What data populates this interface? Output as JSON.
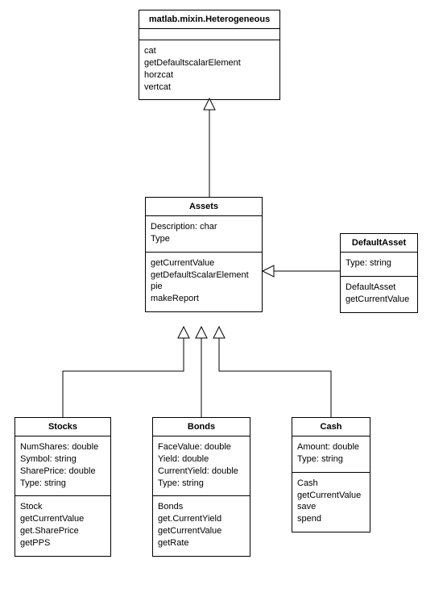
{
  "classes": {
    "heterogeneous": {
      "name": "matlab.mixin.Heterogeneous",
      "attributes": [],
      "methods": [
        "cat",
        "getDefaultscalarElement",
        "horzcat",
        "vertcat"
      ]
    },
    "assets": {
      "name": "Assets",
      "attributes": [
        "Description: char",
        "Type"
      ],
      "methods": [
        "getCurrentValue",
        "getDefaultScalarElement",
        "pie",
        "makeReport"
      ]
    },
    "defaultAsset": {
      "name": "DefaultAsset",
      "attributes": [
        "Type: string"
      ],
      "methods": [
        "DefaultAsset",
        "getCurrentValue"
      ]
    },
    "stocks": {
      "name": "Stocks",
      "attributes": [
        "NumShares: double",
        "Symbol: string",
        "SharePrice: double",
        "Type: string"
      ],
      "methods": [
        "Stock",
        "getCurrentValue",
        "get.SharePrice",
        "getPPS"
      ]
    },
    "bonds": {
      "name": "Bonds",
      "attributes": [
        "FaceValue: double",
        "Yield: double",
        "CurrentYield: double",
        "Type: string"
      ],
      "methods": [
        "Bonds",
        "get.CurrentYield",
        "getCurrentValue",
        "getRate"
      ]
    },
    "cash": {
      "name": "Cash",
      "attributes": [
        "Amount: double",
        "Type: string"
      ],
      "methods": [
        "Cash",
        "getCurrentValue",
        "save",
        "spend"
      ]
    }
  },
  "relationships": [
    {
      "from": "assets",
      "to": "heterogeneous",
      "type": "generalization"
    },
    {
      "from": "defaultAsset",
      "to": "assets",
      "type": "generalization"
    },
    {
      "from": "stocks",
      "to": "assets",
      "type": "generalization"
    },
    {
      "from": "bonds",
      "to": "assets",
      "type": "generalization"
    },
    {
      "from": "cash",
      "to": "assets",
      "type": "generalization"
    }
  ]
}
